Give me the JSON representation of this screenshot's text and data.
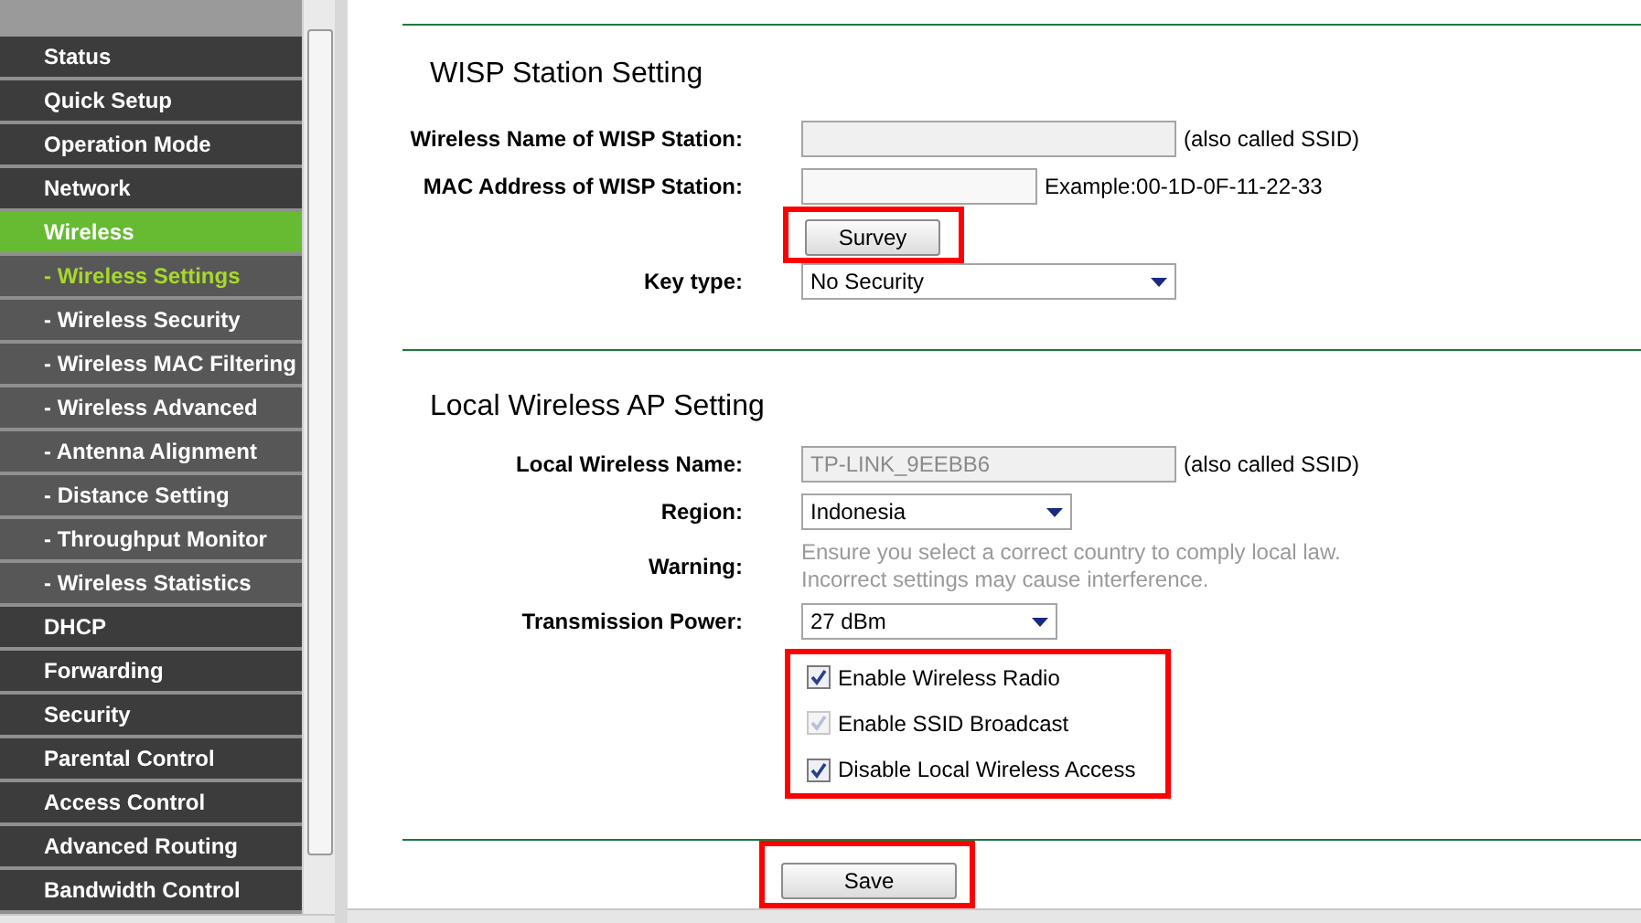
{
  "sidebar": {
    "items": [
      {
        "label": "Status",
        "kind": "main",
        "selected": false
      },
      {
        "label": "Quick Setup",
        "kind": "main",
        "selected": false
      },
      {
        "label": "Operation Mode",
        "kind": "main",
        "selected": false
      },
      {
        "label": "Network",
        "kind": "main",
        "selected": false
      },
      {
        "label": "Wireless",
        "kind": "main",
        "selected": true
      },
      {
        "label": "- Wireless Settings",
        "kind": "sub",
        "selected": true
      },
      {
        "label": "- Wireless Security",
        "kind": "sub",
        "selected": false
      },
      {
        "label": "- Wireless MAC Filtering",
        "kind": "sub",
        "selected": false
      },
      {
        "label": "- Wireless Advanced",
        "kind": "sub",
        "selected": false
      },
      {
        "label": "- Antenna Alignment",
        "kind": "sub",
        "selected": false
      },
      {
        "label": "- Distance Setting",
        "kind": "sub",
        "selected": false
      },
      {
        "label": "- Throughput Monitor",
        "kind": "sub",
        "selected": false
      },
      {
        "label": "- Wireless Statistics",
        "kind": "sub",
        "selected": false
      },
      {
        "label": "DHCP",
        "kind": "main",
        "selected": false
      },
      {
        "label": "Forwarding",
        "kind": "main",
        "selected": false
      },
      {
        "label": "Security",
        "kind": "main",
        "selected": false
      },
      {
        "label": "Parental Control",
        "kind": "main",
        "selected": false
      },
      {
        "label": "Access Control",
        "kind": "main",
        "selected": false
      },
      {
        "label": "Advanced Routing",
        "kind": "main",
        "selected": false
      },
      {
        "label": "Bandwidth Control",
        "kind": "main",
        "selected": false
      }
    ]
  },
  "wisp": {
    "title": "WISP Station Setting",
    "wireless_name": {
      "label": "Wireless Name of WISP Station:",
      "note": "(also called SSID)"
    },
    "mac_address": {
      "label": "MAC Address of WISP Station:",
      "note": "Example:00-1D-0F-11-22-33"
    },
    "survey_button": "Survey",
    "key_type": {
      "label": "Key type:",
      "value": "No Security"
    }
  },
  "local_ap": {
    "title": "Local Wireless AP Setting",
    "local_name": {
      "label": "Local Wireless Name:",
      "value": "TP-LINK_9EEBB6",
      "note": "(also called SSID)",
      "disabled": true
    },
    "region": {
      "label": "Region:",
      "value": "Indonesia"
    },
    "warning": {
      "label": "Warning:",
      "text": "Ensure you select a correct country to comply local law.",
      "text_2": "Incorrect settings may cause interference."
    },
    "transmission_power": {
      "label": "Transmission Power:",
      "value": "27 dBm"
    },
    "options": [
      {
        "label": "Enable Wireless Radio",
        "checked": true,
        "disabled": false
      },
      {
        "label": "Enable SSID Broadcast",
        "checked": true,
        "disabled": true
      },
      {
        "label": "Disable Local Wireless Access",
        "checked": true,
        "disabled": false
      }
    ]
  },
  "save_button": "Save"
}
